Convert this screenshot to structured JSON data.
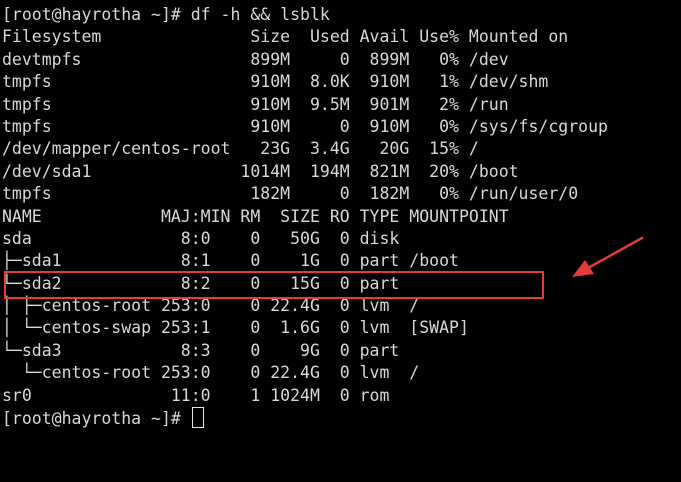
{
  "terminal": {
    "lines": [
      "[root@hayrotha ~]# df -h && lsblk",
      "Filesystem               Size  Used Avail Use% Mounted on",
      "devtmpfs                 899M     0  899M   0% /dev",
      "tmpfs                    910M  8.0K  910M   1% /dev/shm",
      "tmpfs                    910M  9.5M  901M   2% /run",
      "tmpfs                    910M     0  910M   0% /sys/fs/cgroup",
      "/dev/mapper/centos-root   23G  3.4G   20G  15% /",
      "/dev/sda1               1014M  194M  821M  20% /boot",
      "tmpfs                    182M     0  182M   0% /run/user/0",
      "NAME            MAJ:MIN RM  SIZE RO TYPE MOUNTPOINT",
      "sda               8:0    0   50G  0 disk",
      "├─sda1            8:1    0    1G  0 part /boot",
      "└─sda2            8:2    0   15G  0 part",
      "│ ├─centos-root 253:0    0 22.4G  0 lvm  /",
      "│ └─centos-swap 253:1    0  1.6G  0 lvm  [SWAP]",
      "└─sda3            8:3    0    9G  0 part",
      "  └─centos-root 253:0    0 22.4G  0 lvm  /",
      "sr0              11:0    1 1024M  0 rom",
      "[root@hayrotha ~]# "
    ]
  },
  "colors": {
    "background": "#000000",
    "foreground": "#d8d8d8",
    "annotation": "#e23b3b"
  },
  "annotations": {
    "highlighted_row": "sda2",
    "arrow_icon": "red-arrow-icon"
  }
}
